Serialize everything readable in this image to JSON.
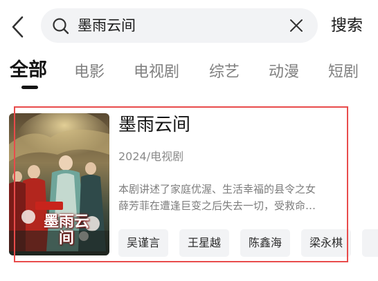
{
  "header": {
    "search_value": "墨雨云间",
    "search_button": "搜索"
  },
  "tabs": [
    {
      "label": "全部",
      "active": true
    },
    {
      "label": "电影",
      "active": false
    },
    {
      "label": "电视剧",
      "active": false
    },
    {
      "label": "综艺",
      "active": false
    },
    {
      "label": "动漫",
      "active": false
    },
    {
      "label": "短剧",
      "active": false
    }
  ],
  "result": {
    "poster_title": "墨雨云间",
    "title": "墨雨云间",
    "meta": "2024/电视剧",
    "description_lines": [
      "本剧讲述了家庭优渥、生活幸福的县令之女",
      "薛芳菲在遭逢巨变之后失去一切，受救命…"
    ],
    "cast": [
      "吴谨言",
      "王星越",
      "陈鑫海",
      "梁永棋"
    ]
  },
  "colors": {
    "highlight": "#e84b4b",
    "search_bg": "#f2f3f5",
    "chip_bg": "#f2f3f5",
    "active_tab": "#141414",
    "inactive_tab": "#808080"
  }
}
